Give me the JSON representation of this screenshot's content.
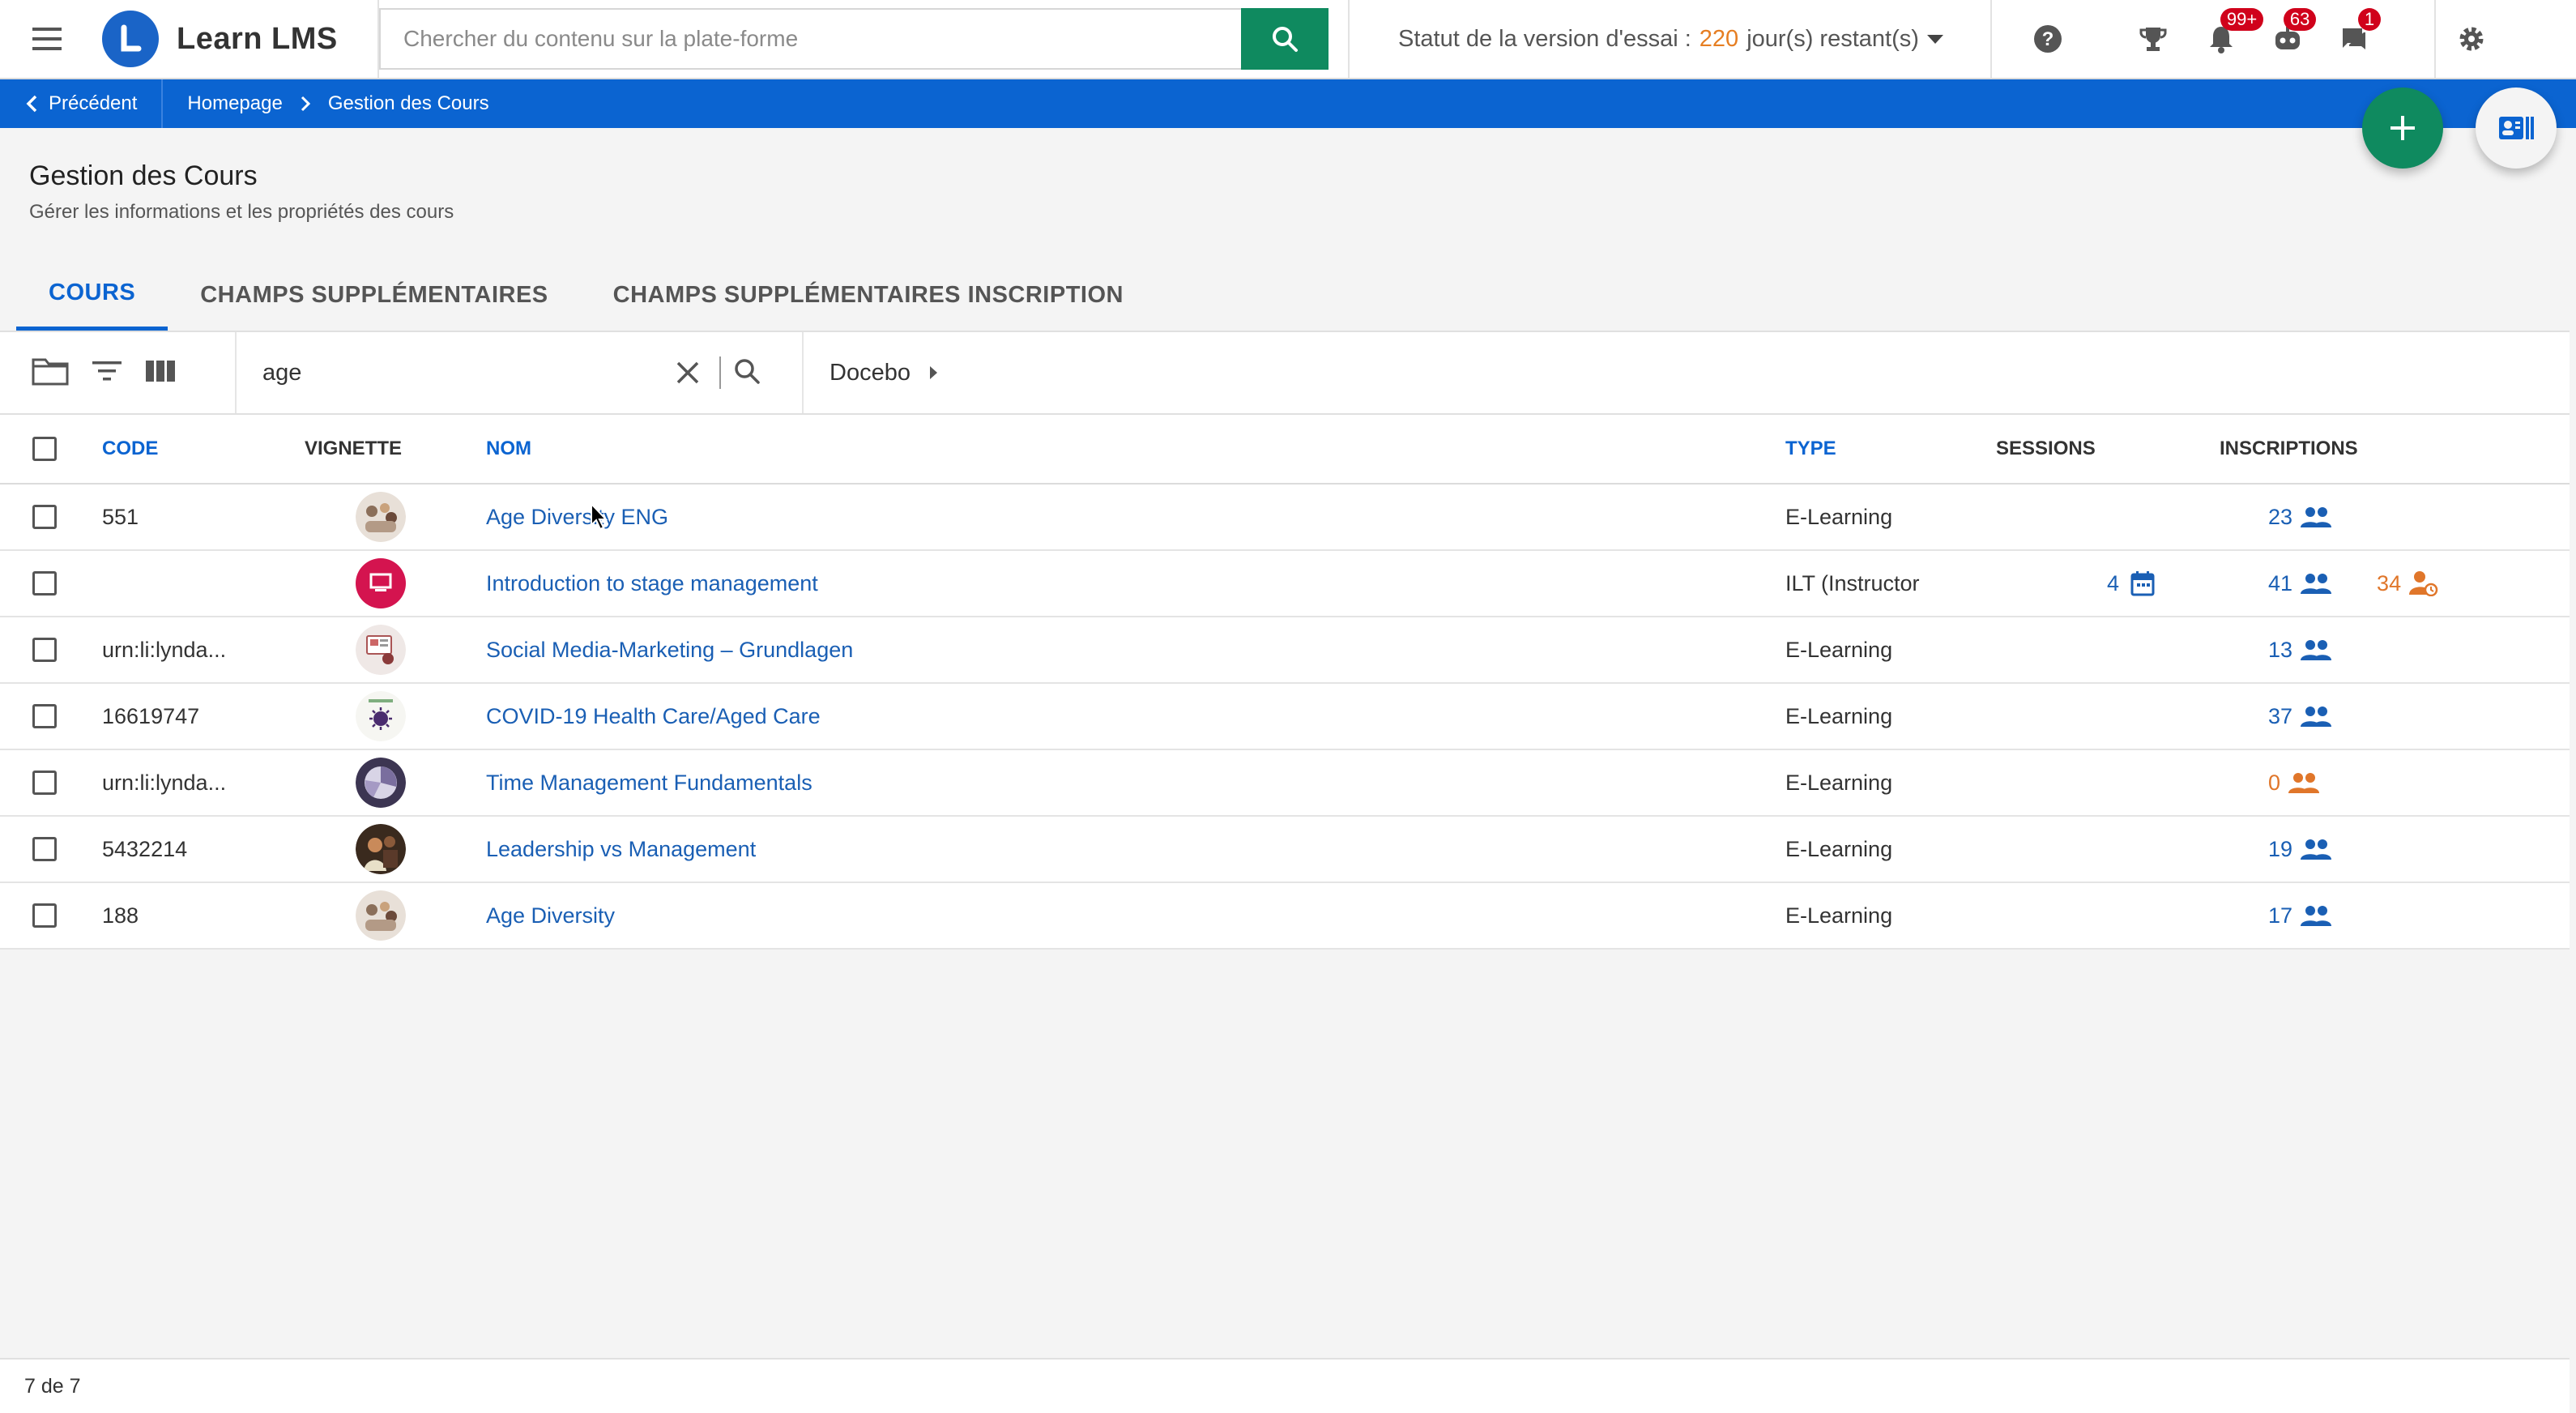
{
  "header": {
    "brand": "Learn LMS",
    "search_placeholder": "Chercher du contenu sur la plate-forme",
    "trial_prefix": "Statut de la version d'essai :",
    "trial_days": "220",
    "trial_suffix": "jour(s) restant(s)",
    "badges": {
      "notifications": "99+",
      "chat": "63",
      "messages": "1"
    }
  },
  "breadcrumb": {
    "back_label": "Précédent",
    "home": "Homepage",
    "current": "Gestion des Cours"
  },
  "page": {
    "title": "Gestion des Cours",
    "subtitle": "Gérer les informations et les propriétés des cours"
  },
  "tabs": [
    {
      "label": "COURS",
      "active": true
    },
    {
      "label": "CHAMPS SUPPLÉMENTAIRES",
      "active": false
    },
    {
      "label": "CHAMPS SUPPLÉMENTAIRES INSCRIPTION",
      "active": false
    }
  ],
  "toolbar": {
    "search_value": "age",
    "catalog_crumb": "Docebo"
  },
  "table": {
    "columns": {
      "code": "CODE",
      "thumbnail": "VIGNETTE",
      "name": "NOM",
      "type": "TYPE",
      "sessions": "SESSIONS",
      "enrollments": "INSCRIPTIONS"
    },
    "rows": [
      {
        "code": "551",
        "name": "Age Diversity ENG",
        "type": "E-Learning",
        "sessions": "",
        "enrollments": "23",
        "pending": ""
      },
      {
        "code": "",
        "name": "Introduction to stage management",
        "type": "ILT (Instructor",
        "sessions": "4",
        "enrollments": "41",
        "pending": "34"
      },
      {
        "code": "urn:li:lynda...",
        "name": "Social Media-Marketing – Grundlagen",
        "type": "E-Learning",
        "sessions": "",
        "enrollments": "13",
        "pending": ""
      },
      {
        "code": "16619747",
        "name": "COVID-19 Health Care/Aged Care",
        "type": "E-Learning",
        "sessions": "",
        "enrollments": "37",
        "pending": ""
      },
      {
        "code": "urn:li:lynda...",
        "name": "Time Management Fundamentals",
        "type": "E-Learning",
        "sessions": "",
        "enrollments": "0",
        "pending": ""
      },
      {
        "code": "5432214",
        "name": "Leadership vs Management",
        "type": "E-Learning",
        "sessions": "",
        "enrollments": "19",
        "pending": ""
      },
      {
        "code": "188",
        "name": "Age Diversity",
        "type": "E-Learning",
        "sessions": "",
        "enrollments": "17",
        "pending": ""
      }
    ]
  },
  "footer": {
    "count": "7 de 7"
  },
  "colors": {
    "primary_blue": "#0b64d1",
    "link_blue": "#1a5fb4",
    "green": "#0f8a5f",
    "orange": "#e0762a",
    "badge_red": "#d0021b"
  }
}
